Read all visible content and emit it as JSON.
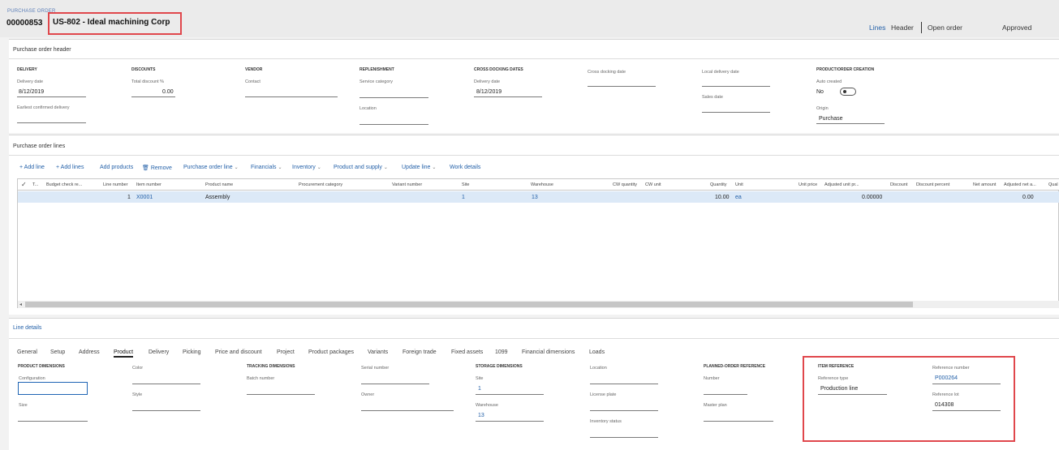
{
  "header": {
    "caption": "PURCHASE ORDER",
    "po_number": "00000853",
    "vendor_title": "US-802 - Ideal machining Corp",
    "nav": {
      "lines": "Lines",
      "header": "Header",
      "open_order": "Open order",
      "status": "Approved"
    }
  },
  "po_header": {
    "title": "Purchase order header",
    "delivery": {
      "group": "DELIVERY",
      "delivery_date_label": "Delivery date",
      "delivery_date": "8/12/2019",
      "earliest_label": "Earliest confirmed delivery"
    },
    "discounts": {
      "group": "DISCOUNTS",
      "total_discount_label": "Total discount %",
      "total_discount": "0.00"
    },
    "vendor": {
      "group": "VENDOR",
      "contact_label": "Contact"
    },
    "replenishment": {
      "group": "REPLENISHMENT",
      "service_category_label": "Service category",
      "location_label": "Location"
    },
    "cross_docking": {
      "group": "CROSS DOCKING DATES",
      "delivery_date_label": "Delivery date",
      "delivery_date": "8/12/2019",
      "cross_docking_date_label": "Cross docking date"
    },
    "local": {
      "local_delivery_label": "Local delivery date",
      "sales_date_label": "Sales date"
    },
    "product_creation": {
      "group": "PRODUCT/ORDER CREATION",
      "auto_created_label": "Auto created",
      "auto_created": "No",
      "origin_label": "Origin",
      "origin": "Purchase"
    }
  },
  "po_lines": {
    "title": "Purchase order lines",
    "toolbar": {
      "add_line": "+ Add line",
      "add_lines": "+ Add lines",
      "add_products": "Add products",
      "remove": "Remove",
      "purchase_order_line": "Purchase order line",
      "financials": "Financials",
      "inventory": "Inventory",
      "product_and_supply": "Product and supply",
      "update_line": "Update line",
      "work_details": "Work details"
    },
    "columns": {
      "t": "T...",
      "budget_check": "Budget check re...",
      "line_number": "Line number",
      "item_number": "Item number",
      "product_name": "Product name",
      "procurement_category": "Procurement category",
      "variant_number": "Variant number",
      "site": "Site",
      "warehouse": "Warehouse",
      "cw_quantity": "CW quantity",
      "cw_unit": "CW unit",
      "quantity": "Quantity",
      "unit": "Unit",
      "unit_price": "Unit price",
      "adjusted_unit_price": "Adjusted unit pr...",
      "discount": "Discount",
      "discount_percent": "Discount percent",
      "net_amount": "Net amount",
      "adjusted_net": "Adjusted net a...",
      "qual": "Qual"
    },
    "rows": [
      {
        "line_number": "1",
        "item_number": "X0001",
        "product_name": "Assembly",
        "site": "1",
        "warehouse": "13",
        "quantity": "10.00",
        "unit": "ea",
        "adjusted_unit_price": "0.00000",
        "adjusted_net": "0.00"
      }
    ]
  },
  "line_details": {
    "title": "Line details",
    "tabs": [
      "General",
      "Setup",
      "Address",
      "Product",
      "Delivery",
      "Picking",
      "Price and discount",
      "Project",
      "Product packages",
      "Variants",
      "Foreign trade",
      "Fixed assets",
      "1099",
      "Financial dimensions",
      "Loads"
    ],
    "active_tab": "Product",
    "product_dimensions": {
      "group": "PRODUCT DIMENSIONS",
      "configuration_label": "Configuration",
      "size_label": "Size",
      "color_label": "Color",
      "style_label": "Style"
    },
    "tracking_dimensions": {
      "group": "TRACKING DIMENSIONS",
      "batch_label": "Batch number",
      "serial_label": "Serial number",
      "owner_label": "Owner"
    },
    "storage_dimensions": {
      "group": "STORAGE DIMENSIONS",
      "site_label": "Site",
      "site": "1",
      "warehouse_label": "Warehouse",
      "warehouse": "13",
      "location_label": "Location",
      "license_plate_label": "License plate",
      "inventory_status_label": "Inventory status"
    },
    "planned_order_reference": {
      "group": "PLANNED-ORDER REFERENCE",
      "number_label": "Number",
      "master_plan_label": "Master plan"
    },
    "item_reference": {
      "group": "ITEM REFERENCE",
      "reference_type_label": "Reference type",
      "reference_type": "Production line",
      "reference_number_label": "Reference number",
      "reference_number": "P000264",
      "reference_lot_label": "Reference lot",
      "reference_lot": "014308"
    }
  },
  "colors": {
    "accent": "#2360a8",
    "highlight": "#e0474c",
    "selected_row": "#dce9f7"
  }
}
